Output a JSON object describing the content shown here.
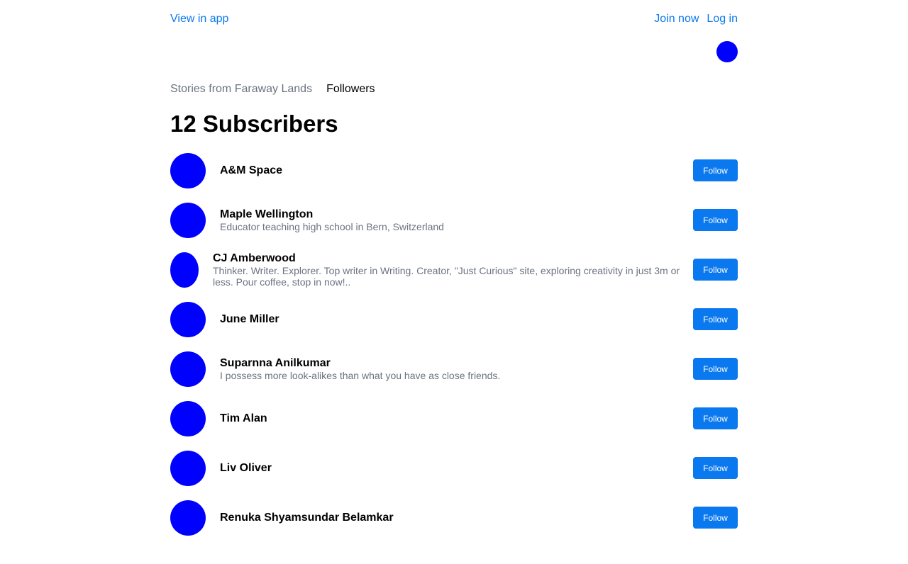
{
  "topbar": {
    "view_in_app": "View in app",
    "join_now": "Join now",
    "log_in": "Log in"
  },
  "breadcrumb": {
    "publication": "Stories from Faraway Lands",
    "current": "Followers"
  },
  "page_title": "12 Subscribers",
  "follow_label": "Follow",
  "subscribers": [
    {
      "name": "A&M Space",
      "bio": ""
    },
    {
      "name": "Maple Wellington",
      "bio": "Educator teaching high school in Bern, Switzerland"
    },
    {
      "name": "CJ Amberwood",
      "bio": "Thinker. Writer. Explorer. Top writer in Writing. Creator, \"Just Curious\" site, exploring creativity in just 3m or less. Pour coffee, stop in now!.."
    },
    {
      "name": "June Miller",
      "bio": ""
    },
    {
      "name": "Suparnna Anilkumar",
      "bio": "I possess more look-alikes than what you have as close friends."
    },
    {
      "name": "Tim Alan",
      "bio": ""
    },
    {
      "name": "Liv Oliver",
      "bio": ""
    },
    {
      "name": "Renuka Shyamsundar Belamkar",
      "bio": ""
    }
  ],
  "colors": {
    "accent": "#0a78ee",
    "avatar": "#0000ff",
    "muted_text": "#6b7280"
  }
}
